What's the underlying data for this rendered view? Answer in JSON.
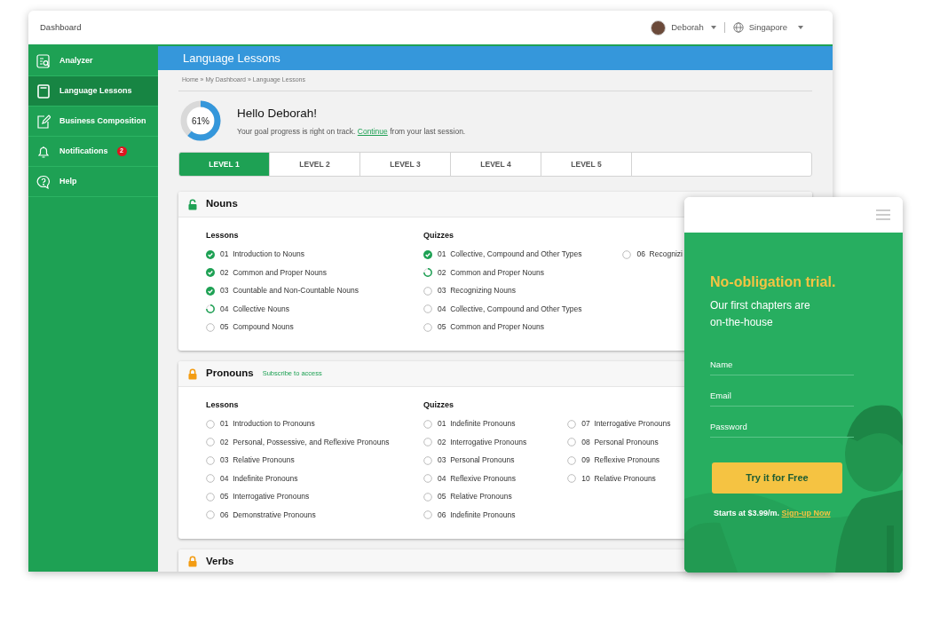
{
  "window": {
    "title": "Dashboard"
  },
  "user_menu": {
    "name": "Deborah"
  },
  "region_menu": {
    "label": "Singapore"
  },
  "sidebar": {
    "items": [
      {
        "label": "Analyzer",
        "selected": false
      },
      {
        "label": "Language Lessons",
        "selected": true
      },
      {
        "label": "Business Composition",
        "selected": false
      },
      {
        "label": "Notifications",
        "selected": false,
        "badge": "2"
      },
      {
        "label": "Help",
        "selected": false
      }
    ]
  },
  "page_title": "Language Lessons",
  "breadcrumb": "Home » My Dashboard » Language Lessons",
  "progress": {
    "label": "61%",
    "level": 0.61
  },
  "greeting": {
    "title": "Hello Deborah!",
    "text_before": "Your goal progress is right on track.",
    "link": "Continue",
    "text_after": "from your last session."
  },
  "level_tabs": [
    {
      "label": "LEVEL 1",
      "selected": true
    },
    {
      "label": "LEVEL 2",
      "selected": false
    },
    {
      "label": "LEVEL 3",
      "selected": false
    },
    {
      "label": "LEVEL 4",
      "selected": false
    },
    {
      "label": "LEVEL 5",
      "selected": false
    }
  ],
  "sections": [
    {
      "title": "Nouns",
      "locked": false,
      "lessons": {
        "heading": "Lessons",
        "items": [
          {
            "number": "01",
            "label": "Introduction to Nouns",
            "kind": "done"
          },
          {
            "number": "02",
            "label": "Common and Proper Nouns",
            "kind": "done"
          },
          {
            "number": "03",
            "label": "Countable and Non-Countable Nouns",
            "kind": "done"
          },
          {
            "number": "04",
            "label": "Collective Nouns",
            "kind": "progress"
          },
          {
            "number": "05",
            "label": "Compound Nouns",
            "kind": "todo"
          }
        ]
      },
      "quizzes": {
        "heading": "Quizzes",
        "columns": [
          {
            "items": [
              {
                "number": "01",
                "label": "Collective, Compound and Other Types",
                "kind": "done"
              },
              {
                "number": "02",
                "label": "Common and Proper Nouns",
                "kind": "progress"
              },
              {
                "number": "03",
                "label": "Recognizing Nouns",
                "kind": "todo"
              },
              {
                "number": "04",
                "label": "Collective, Compound and Other Types",
                "kind": "todo"
              },
              {
                "number": "05",
                "label": "Common and Proper Nouns",
                "kind": "todo"
              }
            ]
          },
          {
            "items": [
              {
                "number": "06",
                "label": "Recognizi",
                "kind": "todo"
              }
            ]
          }
        ]
      }
    },
    {
      "title": "Pronouns",
      "locked": true,
      "note": "Subscribe to access",
      "lessons": {
        "heading": "Lessons",
        "items": [
          {
            "number": "01",
            "label": "Introduction to Pronouns",
            "kind": "todo"
          },
          {
            "number": "02",
            "label": "Personal, Possessive, and Reflexive Pronouns",
            "kind": "todo"
          },
          {
            "number": "03",
            "label": "Relative Pronouns",
            "kind": "todo"
          },
          {
            "number": "04",
            "label": "Indefinite Pronouns",
            "kind": "todo"
          },
          {
            "number": "05",
            "label": "Interrogative Pronouns",
            "kind": "todo"
          },
          {
            "number": "06",
            "label": "Demonstrative Pronouns",
            "kind": "todo"
          }
        ]
      },
      "quizzes": {
        "heading": "Quizzes",
        "columns": [
          {
            "items": [
              {
                "number": "01",
                "label": "Indefinite Pronouns",
                "kind": "todo"
              },
              {
                "number": "02",
                "label": "Interrogative Pronouns",
                "kind": "todo"
              },
              {
                "number": "03",
                "label": "Personal Pronouns",
                "kind": "todo"
              },
              {
                "number": "04",
                "label": "Reflexive Pronouns",
                "kind": "todo"
              },
              {
                "number": "05",
                "label": "Relative Pronouns",
                "kind": "todo"
              },
              {
                "number": "06",
                "label": "Indefinite Pronouns",
                "kind": "todo"
              }
            ]
          },
          {
            "items": [
              {
                "number": "07",
                "label": "Interrogative Pronouns",
                "kind": "todo"
              },
              {
                "number": "08",
                "label": "Personal Pronouns",
                "kind": "todo"
              },
              {
                "number": "09",
                "label": "Reflexive Pronouns",
                "kind": "todo"
              },
              {
                "number": "10",
                "label": "Relative Pronouns",
                "kind": "todo"
              }
            ]
          }
        ]
      }
    },
    {
      "title": "Verbs",
      "locked": true
    }
  ],
  "mobile": {
    "headline": "No-obligation trial.",
    "subline": "Our first chapters are on-the-house",
    "fields": [
      {
        "placeholder": "Name"
      },
      {
        "placeholder": "Email"
      },
      {
        "placeholder": "Password"
      }
    ],
    "button": "Try it for Free",
    "footer_text": "Starts at $3.99/m.",
    "footer_link": "Sign-up Now"
  }
}
